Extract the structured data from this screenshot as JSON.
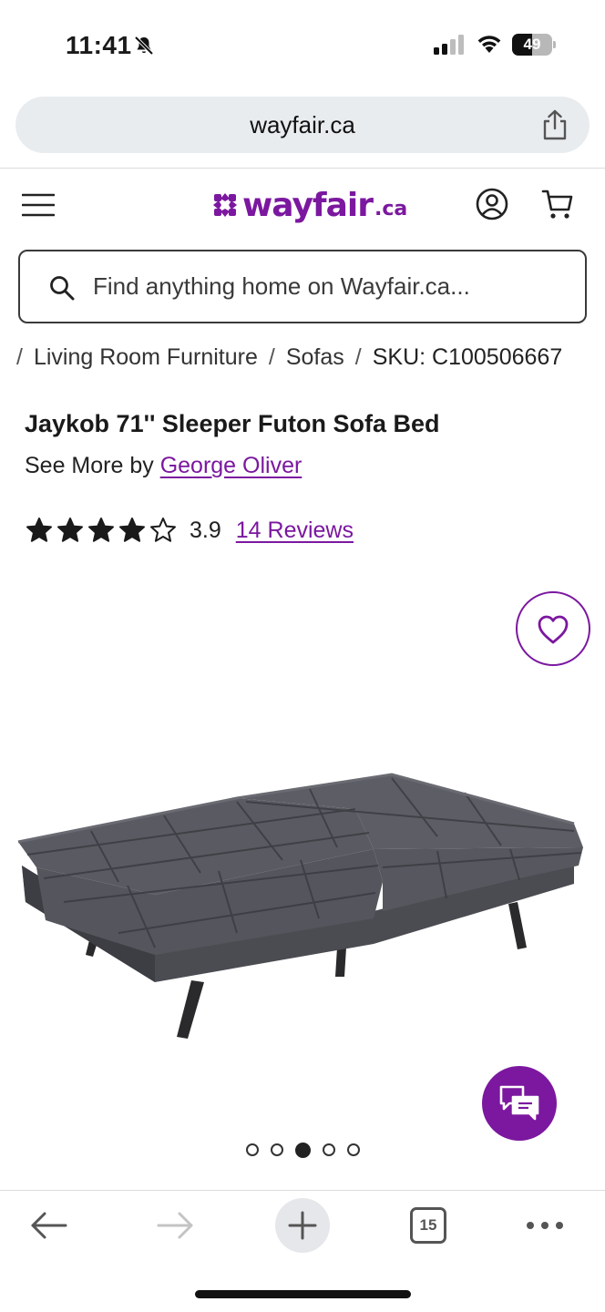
{
  "status_bar": {
    "time": "11:41",
    "battery_level": 49,
    "battery_label": "49"
  },
  "browser": {
    "url": "wayfair.ca",
    "tabs_count": "15"
  },
  "site_header": {
    "logo_text": "wayfair",
    "logo_tld": ".ca",
    "brand_color": "#7b189f"
  },
  "search": {
    "placeholder": "Find anything home on Wayfair.ca..."
  },
  "breadcrumb": {
    "items": [
      "Living Room Furniture",
      "Sofas"
    ],
    "sku": "SKU: C100506667"
  },
  "product": {
    "title": "Jaykob 71'' Sleeper Futon Sofa Bed",
    "see_more_prefix": "See More by ",
    "brand": "George Oliver",
    "rating": 3.9,
    "rating_label": "3.9",
    "stars_filled": 4,
    "stars_total": 5,
    "reviews_label": "14 Reviews"
  },
  "carousel": {
    "total": 5,
    "active_index": 2
  },
  "icons": {
    "status": [
      "bell-slash-icon",
      "signal-icon",
      "wifi-icon",
      "battery-icon"
    ],
    "header": [
      "menu-icon",
      "account-icon",
      "cart-icon"
    ],
    "toolbar": [
      "back-icon",
      "forward-icon",
      "plus-icon",
      "tabs-icon",
      "more-icon"
    ]
  }
}
